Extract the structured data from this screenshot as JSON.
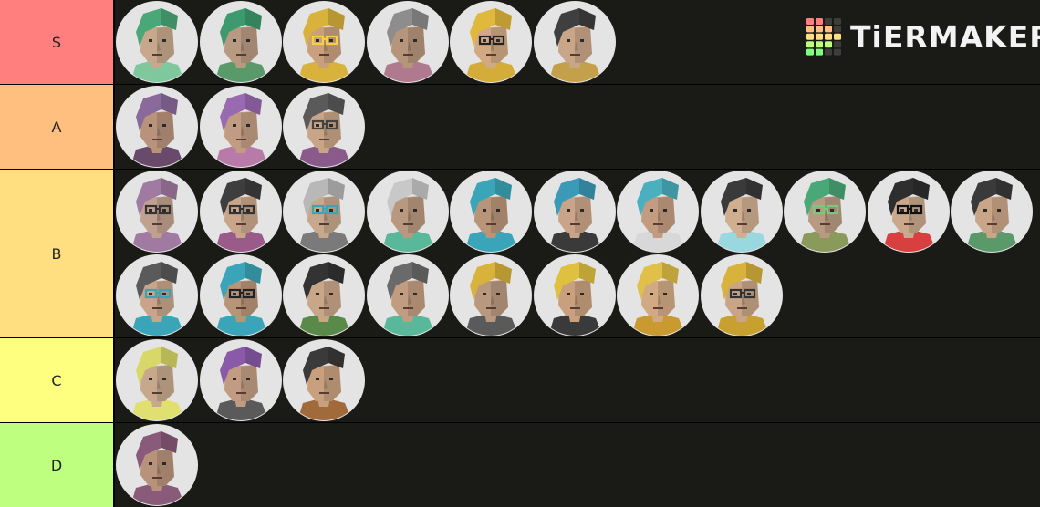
{
  "app": {
    "logo_text": "TiERMAKER",
    "brand_icon": "tiermaker-grid-icon"
  },
  "colors": {
    "background": "#000000",
    "row_bg": "#1a1a17",
    "avatar_bg": "#e4e4e4",
    "logo_grid": [
      "#ff7f7f",
      "#ffbf7f",
      "#ffdf7f",
      "#bfff7f",
      "#7fff7f",
      "#3d3d3d"
    ]
  },
  "tiers": [
    {
      "label": "S",
      "color": "#ff7f7f",
      "avatars": [
        {
          "hair": "#4aa878",
          "skin": "#c7a88c",
          "shirt": "#7fc79c"
        },
        {
          "hair": "#3d9a6e",
          "skin": "#b89a82",
          "shirt": "#5a9a6a"
        },
        {
          "hair": "#d8b23a",
          "skin": "#c9a07e",
          "shirt": "#d8b23a",
          "glasses": "#f5d142"
        },
        {
          "hair": "#8d8d8d",
          "skin": "#b6957a",
          "shirt": "#b07a8e"
        },
        {
          "hair": "#e0b83c",
          "skin": "#d1a982",
          "shirt": "#d3ac3a",
          "glasses": "#222222"
        },
        {
          "hair": "#3f3f3f",
          "skin": "#c9a688",
          "shirt": "#c4a04a"
        }
      ]
    },
    {
      "label": "A",
      "color": "#ffbf7f",
      "avatars": [
        {
          "hair": "#8a6a9a",
          "skin": "#b8927a",
          "shirt": "#6a4a6a"
        },
        {
          "hair": "#9a6ab0",
          "skin": "#c29c82",
          "shirt": "#b87aa8"
        },
        {
          "hair": "#5a5a5a",
          "skin": "#c9a486",
          "shirt": "#8a5a8a",
          "glasses": "#444444"
        }
      ]
    },
    {
      "label": "B",
      "color": "#ffdf7f",
      "avatars": [
        {
          "hair": "#a07aa0",
          "skin": "#c0a08e",
          "shirt": "#a07aa0",
          "glasses": "#333333"
        },
        {
          "hair": "#3e3e3e",
          "skin": "#c9a58a",
          "shirt": "#9a5a8a",
          "glasses": "#333333"
        },
        {
          "hair": "#b8b8b8",
          "skin": "#c7a88c",
          "shirt": "#7a7a7a",
          "glasses": "#3aa5b8"
        },
        {
          "hair": "#c8c8c8",
          "skin": "#b8987e",
          "shirt": "#5ab89a"
        },
        {
          "hair": "#3aa5b8",
          "skin": "#b89478",
          "shirt": "#3aa5b8"
        },
        {
          "hair": "#3a9ab8",
          "skin": "#c9a488",
          "shirt": "#3a3a3a"
        },
        {
          "hair": "#4ab0c0",
          "skin": "#c29c80",
          "shirt": "#d8d8d8"
        },
        {
          "hair": "#3a3a3a",
          "skin": "#d0ae90",
          "shirt": "#9ad8e0"
        },
        {
          "hair": "#4aa878",
          "skin": "#b89a82",
          "shirt": "#8a9a5a",
          "glasses": "#7ac87a"
        },
        {
          "hair": "#2e2e2e",
          "skin": "#c9a88c",
          "shirt": "#d84040",
          "glasses": "#111111"
        },
        {
          "hair": "#3a3a3a",
          "skin": "#c9a688",
          "shirt": "#5a9a6a"
        },
        {
          "hair": "#5a5a5a",
          "skin": "#c7a48a",
          "shirt": "#3aa5b8",
          "glasses": "#3aa5b8"
        },
        {
          "hair": "#3aa5b8",
          "skin": "#b89478",
          "shirt": "#3aa5b8",
          "glasses": "#222222"
        },
        {
          "hair": "#333333",
          "skin": "#c9a688",
          "shirt": "#5a8a4a"
        },
        {
          "hair": "#6a6a6a",
          "skin": "#c29c80",
          "shirt": "#5ab89a"
        },
        {
          "hair": "#d8b23a",
          "skin": "#b8987e",
          "shirt": "#5a5a5a"
        },
        {
          "hair": "#e0c040",
          "skin": "#c9a07e",
          "shirt": "#3a3a3a"
        },
        {
          "hair": "#e0c048",
          "skin": "#d1a982",
          "shirt": "#c89a30"
        },
        {
          "hair": "#d8b23a",
          "skin": "#c9a486",
          "shirt": "#c8a030",
          "glasses": "#333333"
        }
      ]
    },
    {
      "label": "C",
      "color": "#ffff7f",
      "avatars": [
        {
          "hair": "#d8d868",
          "skin": "#c7a88c",
          "shirt": "#e0e070"
        },
        {
          "hair": "#8a5aa8",
          "skin": "#c29c82",
          "shirt": "#5a5a5a"
        },
        {
          "hair": "#3a3a3a",
          "skin": "#c9a07e",
          "shirt": "#a06a3a"
        }
      ]
    },
    {
      "label": "D",
      "color": "#bfff7f",
      "avatars": [
        {
          "hair": "#8a5a7a",
          "skin": "#b8927a",
          "shirt": "#8a5a7a"
        }
      ]
    }
  ]
}
